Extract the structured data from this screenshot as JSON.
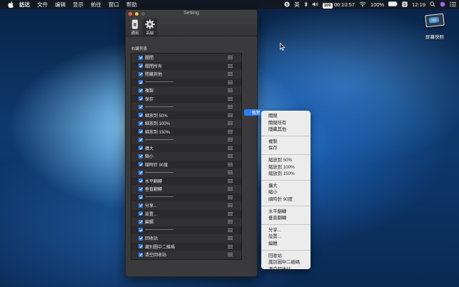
{
  "menubar": {
    "app_name": "訪达",
    "menus": [
      "文件",
      "编辑",
      "显示",
      "前往",
      "窗口",
      "帮助"
    ],
    "status": {
      "input_method": "英",
      "clock_badge": "100",
      "timer": "00:10:57",
      "battery": "100%",
      "time": "12:19"
    }
  },
  "desktop_icon": {
    "label": "屏幕快照"
  },
  "window": {
    "title": "Setting",
    "tabs": [
      {
        "label": "通用",
        "icon": "switch-icon"
      },
      {
        "label": "高級",
        "icon": "gear-icon"
      }
    ],
    "section_title": "右鍵列表",
    "items": [
      "關閉",
      "關閉所有",
      "隱藏其他",
      "--------------------",
      "複製",
      "保存",
      "--------------------",
      "縮放到 50%",
      "縮放到 100%",
      "縮放到 150%",
      "--------------------",
      "擴大",
      "縮小",
      "順時針 90度",
      "--------------------",
      "水平翻轉",
      "垂直翻轉",
      "--------------------",
      "分享...",
      "設置...",
      "編輯",
      "--------------------",
      "回收站",
      "識別圖中二維碼",
      "清空回收站"
    ]
  },
  "preview_button": {
    "label": "預覽"
  },
  "popup_menu": {
    "groups": [
      [
        "關閉",
        "關閉所有",
        "隱藏其他"
      ],
      [
        "複製",
        "保存"
      ],
      [
        "縮放到 50%",
        "縮放到 100%",
        "縮放到 150%"
      ],
      [
        "擴大",
        "縮小",
        "順時針 90度"
      ],
      [
        "水平翻轉",
        "垂直翻轉"
      ],
      [
        "分享...",
        "設置...",
        "編輯"
      ],
      [
        "回收站",
        "識別圖中二維碼",
        "清空回收站"
      ]
    ]
  },
  "colors": {
    "accent": "#2e7cf6",
    "window_bg": "#3a3a3c",
    "menu_bg": "#ececec"
  }
}
